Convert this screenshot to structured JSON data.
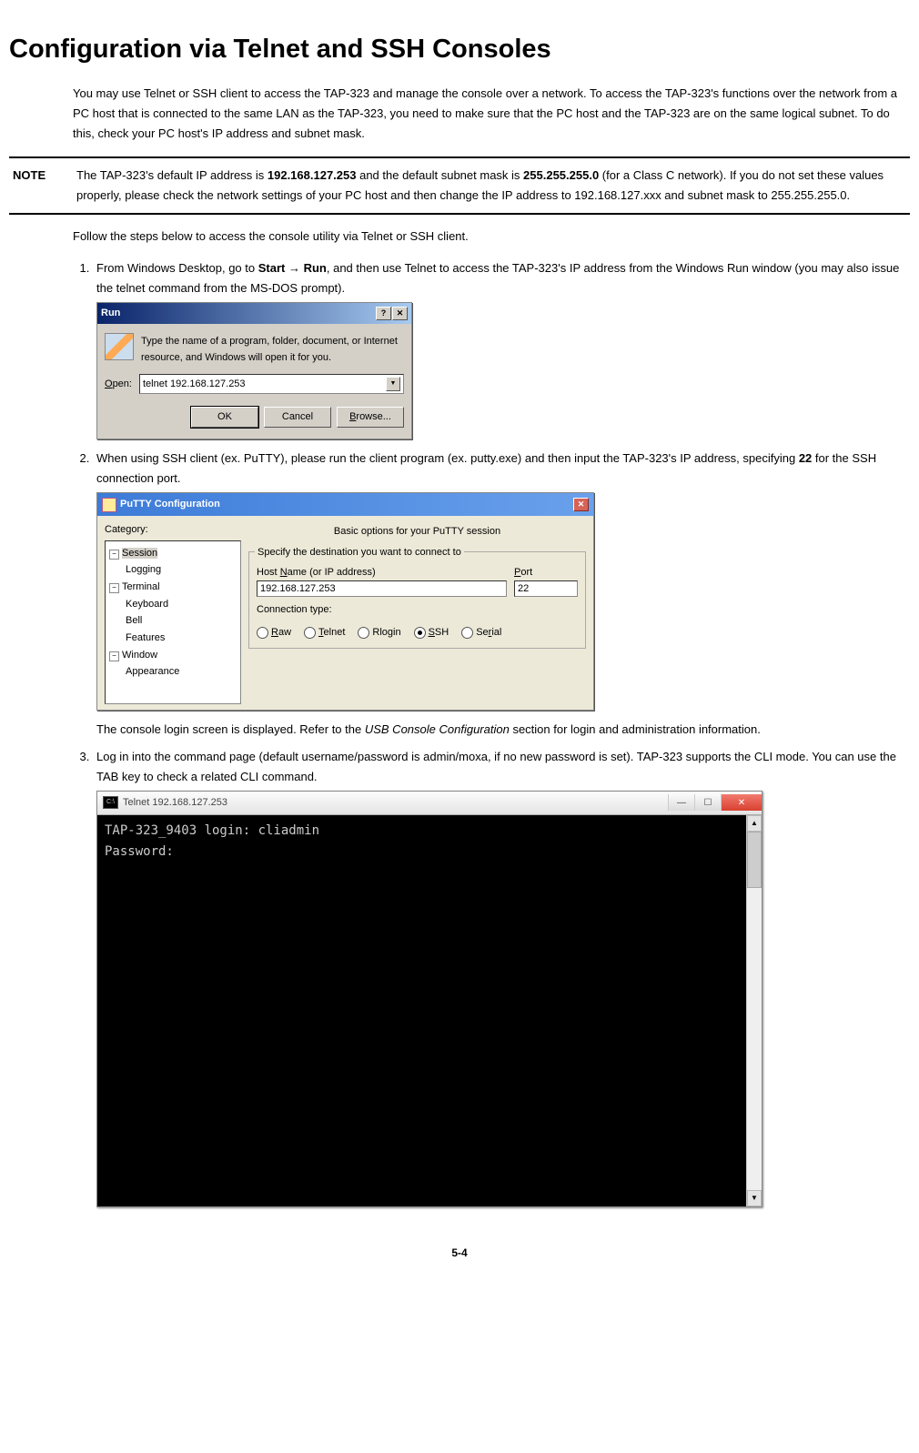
{
  "heading": "Configuration via Telnet and SSH Consoles",
  "intro": "You may use Telnet or SSH client to access the TAP-323 and manage the console over a network. To access the TAP-323's functions over the network from a PC host that is connected to the same LAN as the TAP-323, you need to make sure that the PC host and the TAP-323 are on the same logical subnet. To do this, check your PC host's IP address and subnet mask.",
  "note": {
    "label": "NOTE",
    "part1": "The TAP-323's default IP address is ",
    "ip": "192.168.127.253",
    "part2": " and the default subnet mask is ",
    "mask": "255.255.255.0",
    "part3": " (for a Class C network). If you do not set these values properly, please check the network settings of your PC host and then change the IP address to 192.168.127.xxx and subnet mask to 255.255.255.0."
  },
  "follow": "Follow the steps below to access the console utility via Telnet or SSH client.",
  "step1": {
    "pre": "From Windows Desktop, go to ",
    "b1": "Start ",
    "arrow": "→",
    "b2": " Run",
    "post": ", and then use Telnet to access the TAP-323's IP address from the Windows Run window (you may also issue the telnet command from the MS-DOS prompt)."
  },
  "run": {
    "title": "Run",
    "help_btn": "?",
    "close_btn": "✕",
    "desc": "Type the name of a program, folder, document, or Internet resource, and Windows will open it for you.",
    "open_label": "Open:",
    "open_value": "telnet 192.168.127.253",
    "ok": "OK",
    "cancel": "Cancel",
    "browse": "Browse..."
  },
  "step2": {
    "pre": "When using SSH client (ex. PuTTY), please run the client program (ex. putty.exe) and then input the TAP-323's IP address, specifying ",
    "b1": "22",
    "post": " for the SSH connection port."
  },
  "putty": {
    "title": "PuTTY Configuration",
    "close_btn": "✕",
    "category_label": "Category:",
    "tree": {
      "session": "Session",
      "logging": "Logging",
      "terminal": "Terminal",
      "keyboard": "Keyboard",
      "bell": "Bell",
      "features": "Features",
      "window": "Window",
      "appearance": "Appearance"
    },
    "header": "Basic options for your PuTTY session",
    "group_title": "Specify the destination you want to connect to",
    "host_label_pre": "Host ",
    "host_label_u": "N",
    "host_label_post": "ame (or IP address)",
    "port_label_u": "P",
    "port_label_post": "ort",
    "host_value": "192.168.127.253",
    "port_value": "22",
    "conn_type": "Connection type:",
    "radios": {
      "raw_u": "R",
      "raw": "aw",
      "telnet_u": "T",
      "telnet": "elnet",
      "rlogin": "Rlogin",
      "ssh_u": "S",
      "ssh": "SH",
      "serial": "Serial"
    }
  },
  "after2_pre": "The console login screen is displayed. Refer to the ",
  "after2_i": "USB Console Configuration",
  "after2_post": " section for login and administration information.",
  "step3": "Log in into the command page (default username/password is admin/moxa, if no new password is set). TAP-323 supports the CLI mode. You can use the TAB key to check a related CLI command.",
  "telnet": {
    "title": "Telnet 192.168.127.253",
    "min": "—",
    "max": "☐",
    "close": "✕",
    "line1": "TAP-323_9403 login: cliadmin",
    "line2": "Password:"
  },
  "pagenum": "5-4"
}
